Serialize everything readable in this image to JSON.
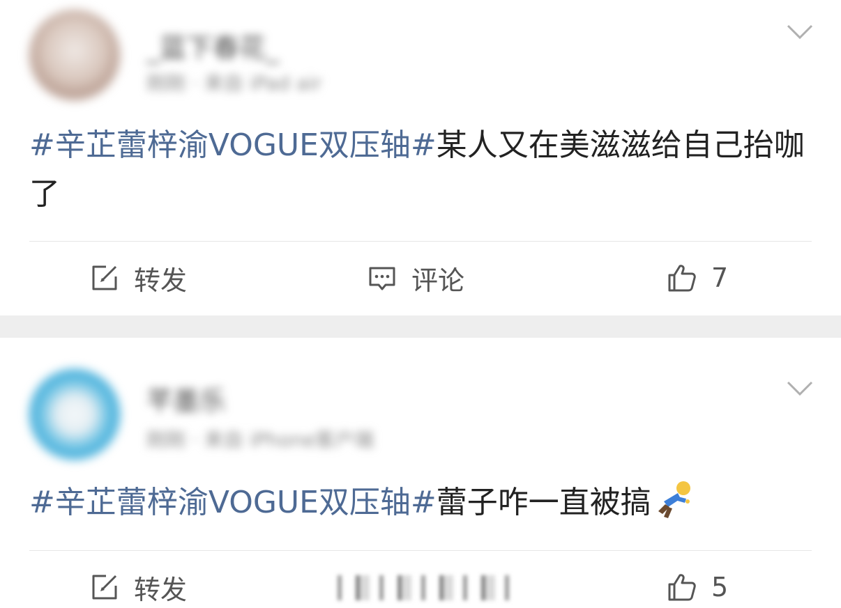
{
  "posts": [
    {
      "username": "_蓝下春花_",
      "meta": "刚刚 · 来自 iPad air",
      "topic": "#辛芷蕾梓渝VOGUE双压轴#",
      "text": "某人又在美滋滋给自己抬咖了",
      "repost_label": "转发",
      "comment_label": "评论",
      "like_count": "7"
    },
    {
      "username": "芊墨乐",
      "meta": "刚刚 · 来自 iPhone客户端",
      "topic": "#辛芷蕾梓渝VOGUE双压轴#",
      "text": "蕾子咋一直被搞",
      "emoji": "running-person-emoji",
      "repost_label": "转发",
      "like_count": "5"
    }
  ],
  "icons": {
    "repost": "edit-share-icon",
    "comment": "comment-bubble-icon",
    "like": "thumbs-up-icon",
    "more": "chevron-down-icon"
  },
  "colors": {
    "topic": "#4e6a94",
    "text": "#222222",
    "action": "#555555",
    "separator": "#eeeeee"
  }
}
